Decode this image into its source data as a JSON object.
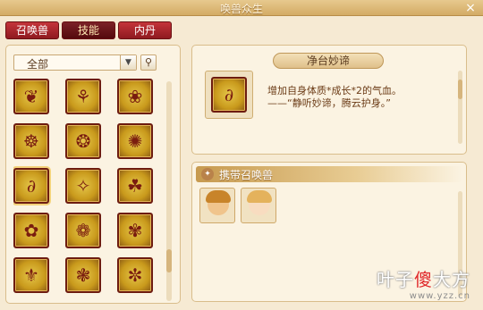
{
  "window": {
    "title": "唤兽众生",
    "close_label": "×"
  },
  "tabs": [
    {
      "label": "召唤兽",
      "active": false
    },
    {
      "label": "技能",
      "active": true
    },
    {
      "label": "内丹",
      "active": false
    }
  ],
  "filter": {
    "selected": "全部",
    "arrow": "▼",
    "search_icon": "search-icon"
  },
  "skill_grid": {
    "selected_index": 6,
    "items": [
      {
        "icon": "skill-icon-1",
        "glyph": "❦"
      },
      {
        "icon": "skill-icon-2",
        "glyph": "⚘"
      },
      {
        "icon": "skill-icon-3",
        "glyph": "❀"
      },
      {
        "icon": "skill-icon-4",
        "glyph": "☸"
      },
      {
        "icon": "skill-icon-5",
        "glyph": "❂"
      },
      {
        "icon": "skill-icon-6",
        "glyph": "✺"
      },
      {
        "icon": "skill-icon-7",
        "glyph": "∂"
      },
      {
        "icon": "skill-icon-8",
        "glyph": "✧"
      },
      {
        "icon": "skill-icon-9",
        "glyph": "☘"
      },
      {
        "icon": "skill-icon-10",
        "glyph": "✿"
      },
      {
        "icon": "skill-icon-11",
        "glyph": "❁"
      },
      {
        "icon": "skill-icon-12",
        "glyph": "✾"
      },
      {
        "icon": "skill-icon-13",
        "glyph": "⚜"
      },
      {
        "icon": "skill-icon-14",
        "glyph": "❃"
      },
      {
        "icon": "skill-icon-15",
        "glyph": "✼"
      }
    ]
  },
  "skill_detail": {
    "name": "净台妙谛",
    "glyph": "∂",
    "desc_line1": "增加自身体质*成长*2的气血。",
    "desc_line2": "——“静听妙谛，腾云护身。”"
  },
  "carry_section": {
    "label": "携带召唤兽",
    "emblem": "✦",
    "avatars": [
      {
        "name": "avatar-warrior",
        "hair": "#c8842a",
        "face": "#f0c48c"
      },
      {
        "name": "avatar-lady",
        "hair": "#e4b25c",
        "face": "#f8dcc0"
      }
    ]
  },
  "watermark": {
    "part1": "叶子",
    "accent": "傻",
    "part2": "大方",
    "url": "www.yzz.cn"
  }
}
